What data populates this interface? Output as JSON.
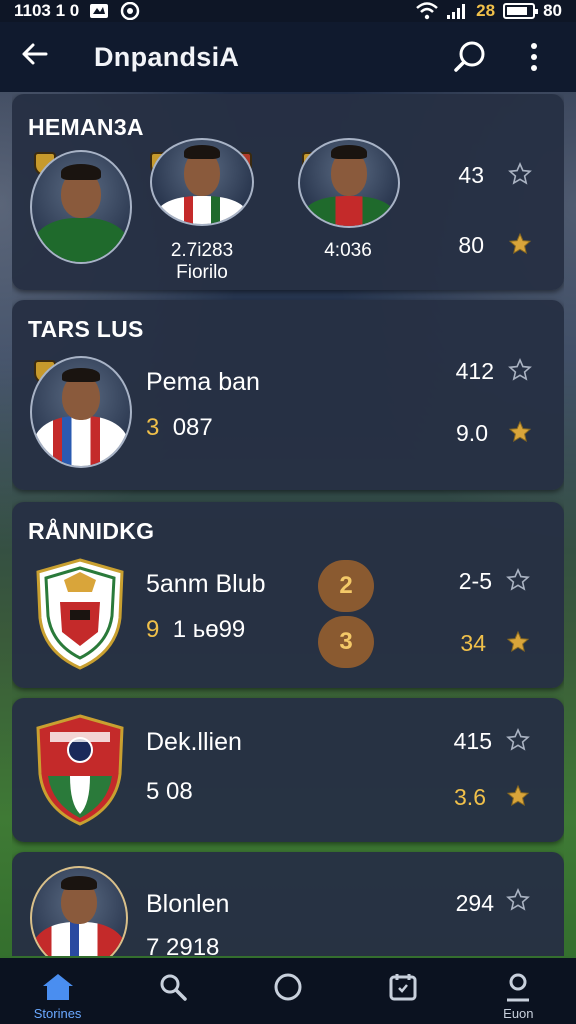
{
  "status_bar": {
    "time": "1103 1 0",
    "battery_text": "80",
    "signal_text": "28"
  },
  "app_bar": {
    "title": "DnpandsiA"
  },
  "cards": [
    {
      "title": "HEMAN3A",
      "players": [
        {
          "under_line1": "",
          "under_line2": ""
        },
        {
          "under_line1": "2.7i283",
          "under_line2": "Fiorilo"
        },
        {
          "under_line1": "4:036",
          "under_line2": ""
        }
      ],
      "top_value": "43",
      "bottom_value": "80"
    },
    {
      "title": "TARS LUS",
      "name": "Pema ban",
      "sub_gold": "3",
      "sub_rest": "087",
      "top_value": "412",
      "bottom_value": "9.0"
    },
    {
      "title": "RÅNNIDKG",
      "name": "5anm Blub",
      "sub_gold": "9",
      "sub_rest": "1 ьө99",
      "pill_top": "2",
      "pill_bottom": "3",
      "top_value": "2-5",
      "bottom_value": "34"
    },
    {
      "name": "Dek.llien",
      "sub_rest": "5  08",
      "top_value": "415",
      "bottom_value": "3.6"
    },
    {
      "name": "Blonlen",
      "sub_rest": "7 2918",
      "top_value": "294"
    }
  ],
  "bottom_nav": [
    {
      "label": "Storines",
      "icon": "home-icon",
      "active": true
    },
    {
      "label": "",
      "icon": "search-icon",
      "active": false
    },
    {
      "label": "",
      "icon": "circle-icon",
      "active": false
    },
    {
      "label": "",
      "icon": "calendar-icon",
      "active": false
    },
    {
      "label": "Euon",
      "icon": "profile-icon",
      "active": false
    }
  ],
  "colors": {
    "accent": "#6aa8ff",
    "gold": "#f0c04a",
    "card": "#263044"
  }
}
